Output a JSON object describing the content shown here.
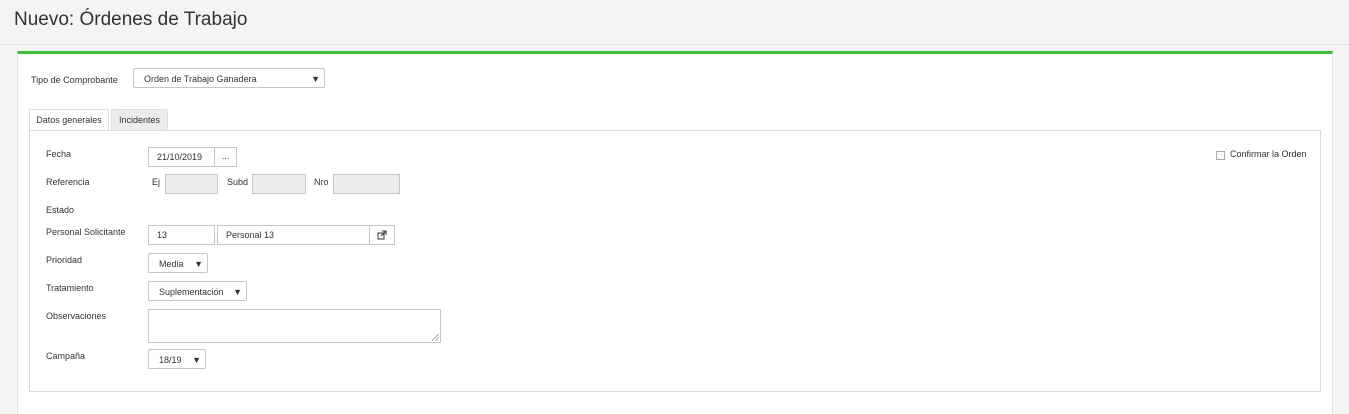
{
  "header": {
    "title": "Nuevo: Órdenes de Trabajo"
  },
  "form": {
    "tipo_comprobante": {
      "label": "Tipo de Comprobante",
      "value": "Orden de Trabajo Ganadera"
    },
    "tabs": [
      {
        "label": "Datos generales",
        "active": true
      },
      {
        "label": "Incidentes",
        "active": false
      }
    ],
    "fecha": {
      "label": "Fecha",
      "value": "21/10/2019",
      "picker": "..."
    },
    "confirmar": {
      "label": "Confirmar la Orden",
      "checked": false
    },
    "referencia": {
      "label": "Referencia",
      "ej_label": "Ej",
      "ej_value": "",
      "subd_label": "Subd",
      "subd_value": "",
      "nro_label": "Nro",
      "nro_value": ""
    },
    "estado": {
      "label": "Estado"
    },
    "personal": {
      "label": "Personal Solicitante",
      "code": "13",
      "name": "Personal 13"
    },
    "prioridad": {
      "label": "Prioridad",
      "value": "Media"
    },
    "tratamiento": {
      "label": "Tratamiento",
      "value": "Suplementación"
    },
    "observaciones": {
      "label": "Observaciones",
      "value": ""
    },
    "campana": {
      "label": "Campaña",
      "value": "18/19"
    }
  },
  "icons": {
    "dropdown": "caret-down-icon",
    "external": "external-link-icon",
    "resize": "resize-grip-icon"
  },
  "colors": {
    "accent": "#3cc13c"
  }
}
